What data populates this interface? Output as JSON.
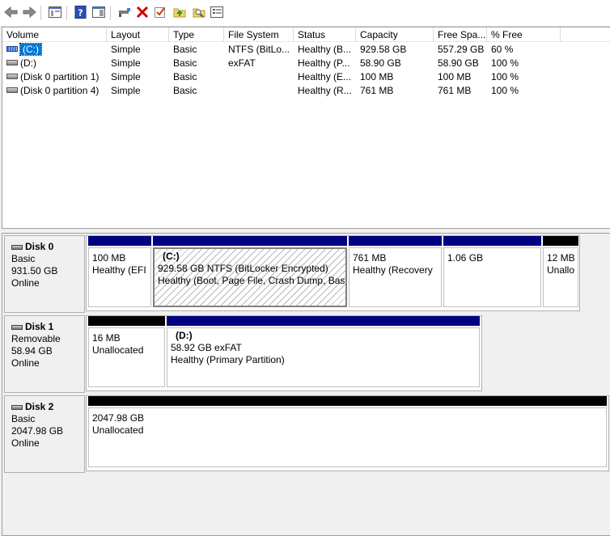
{
  "toolbar": {
    "buttons": [
      "back-icon",
      "forward-icon",
      "console-tree-icon",
      "help-icon",
      "action-pane-icon",
      "connect-icon",
      "delete-icon",
      "check-icon",
      "up-folder-icon",
      "search-folder-icon",
      "properties-icon"
    ]
  },
  "volume_list": {
    "columns": [
      "Volume",
      "Layout",
      "Type",
      "File System",
      "Status",
      "Capacity",
      "Free Spa...",
      "% Free"
    ],
    "rows": [
      {
        "volume": "(C:)",
        "layout": "Simple",
        "type": "Basic",
        "fs": "NTFS (BitLo...",
        "status": "Healthy (B...",
        "capacity": "929.58 GB",
        "free": "557.29 GB",
        "pct": "60 %"
      },
      {
        "volume": "(D:)",
        "layout": "Simple",
        "type": "Basic",
        "fs": "exFAT",
        "status": "Healthy (P...",
        "capacity": "58.90 GB",
        "free": "58.90 GB",
        "pct": "100 %"
      },
      {
        "volume": "(Disk 0 partition 1)",
        "layout": "Simple",
        "type": "Basic",
        "fs": "",
        "status": "Healthy (E...",
        "capacity": "100 MB",
        "free": "100 MB",
        "pct": "100 %"
      },
      {
        "volume": "(Disk 0 partition 4)",
        "layout": "Simple",
        "type": "Basic",
        "fs": "",
        "status": "Healthy (R...",
        "capacity": "761 MB",
        "free": "761 MB",
        "pct": "100 %"
      }
    ]
  },
  "disks": [
    {
      "name": "Disk 0",
      "kind": "Basic",
      "size": "931.50 GB",
      "state": "Online",
      "partitions": [
        {
          "title": "",
          "line1": "100 MB",
          "line2": "Healthy (EFI"
        },
        {
          "title": "(C:)",
          "line1": "929.58 GB NTFS (BitLocker Encrypted)",
          "line2": "Healthy (Boot, Page File, Crash Dump, Basi"
        },
        {
          "title": "",
          "line1": "761 MB",
          "line2": "Healthy (Recovery"
        },
        {
          "title": "",
          "line1": "1.06 GB",
          "line2": ""
        },
        {
          "title": "",
          "line1": "12 MB",
          "line2": "Unallo"
        }
      ]
    },
    {
      "name": "Disk 1",
      "kind": "Removable",
      "size": "58.94 GB",
      "state": "Online",
      "partitions": [
        {
          "title": "",
          "line1": "16 MB",
          "line2": "Unallocated"
        },
        {
          "title": "(D:)",
          "line1": "58.92 GB exFAT",
          "line2": "Healthy (Primary Partition)"
        }
      ]
    },
    {
      "name": "Disk 2",
      "kind": "Basic",
      "size": "2047.98 GB",
      "state": "Online",
      "partitions": [
        {
          "title": "",
          "line1": "2047.98 GB",
          "line2": "Unallocated"
        }
      ]
    }
  ]
}
